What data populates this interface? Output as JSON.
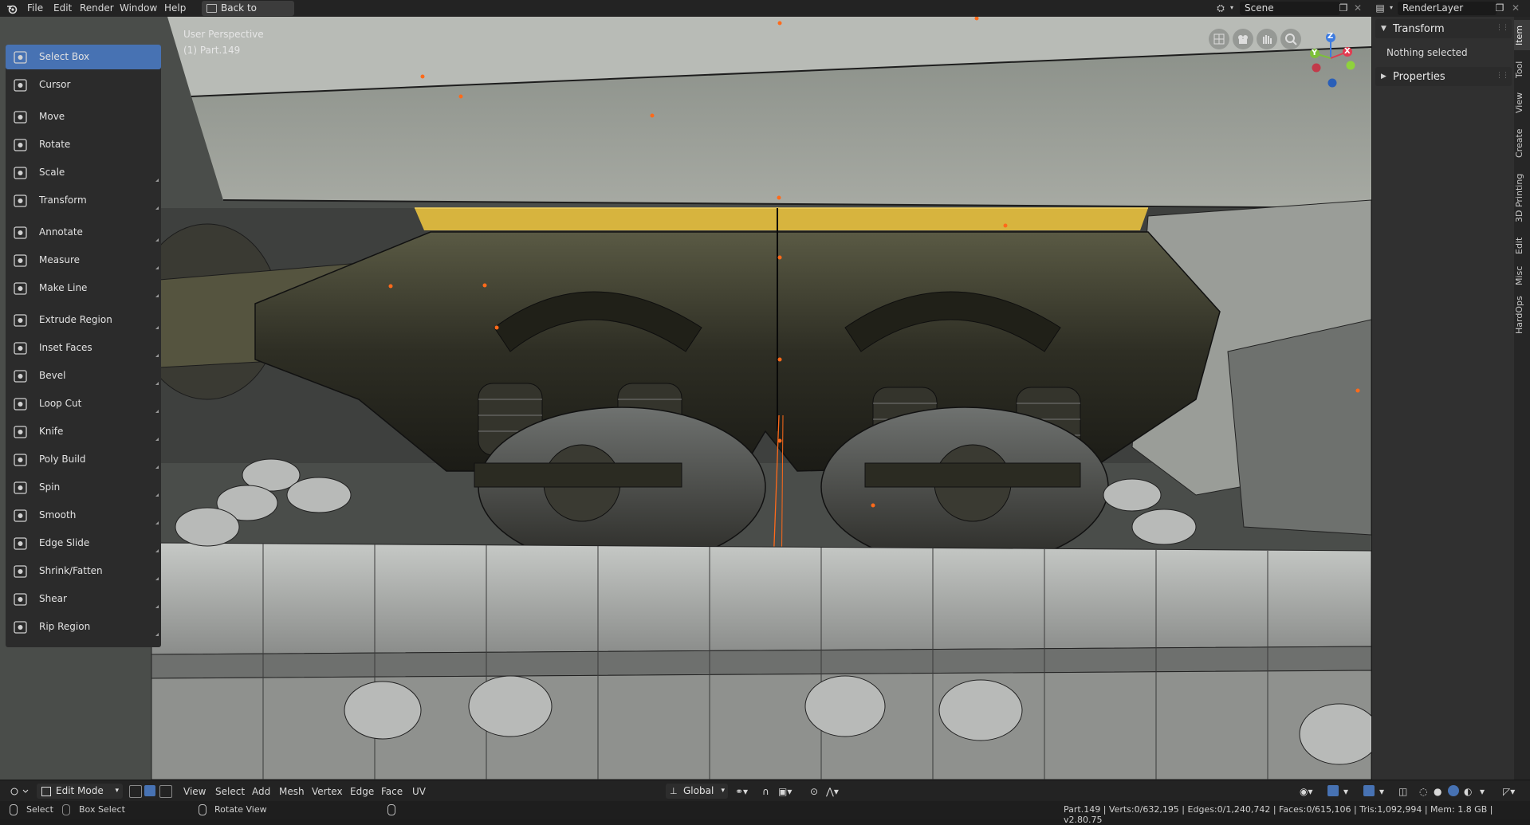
{
  "menu": {
    "items": [
      "File",
      "Edit",
      "Render",
      "Window",
      "Help"
    ],
    "back_to_previous": "Back to Previous"
  },
  "header_right": {
    "scene": "Scene",
    "render_layer": "RenderLayer"
  },
  "toolbar": {
    "tools": [
      {
        "label": "Select Box",
        "icon": "select-box-icon",
        "active": true
      },
      {
        "label": "Cursor",
        "icon": "cursor-icon"
      },
      {
        "label": "Move",
        "icon": "move-icon"
      },
      {
        "label": "Rotate",
        "icon": "rotate-icon"
      },
      {
        "label": "Scale",
        "icon": "scale-icon"
      },
      {
        "label": "Transform",
        "icon": "transform-icon"
      },
      {
        "label": "Annotate",
        "icon": "annotate-icon"
      },
      {
        "label": "Measure",
        "icon": "measure-icon"
      },
      {
        "label": "Make Line",
        "icon": "make-line-icon"
      },
      {
        "label": "Extrude Region",
        "icon": "extrude-region-icon"
      },
      {
        "label": "Inset Faces",
        "icon": "inset-faces-icon"
      },
      {
        "label": "Bevel",
        "icon": "bevel-icon"
      },
      {
        "label": "Loop Cut",
        "icon": "loop-cut-icon"
      },
      {
        "label": "Knife",
        "icon": "knife-icon"
      },
      {
        "label": "Poly Build",
        "icon": "poly-build-icon"
      },
      {
        "label": "Spin",
        "icon": "spin-icon"
      },
      {
        "label": "Smooth",
        "icon": "smooth-icon"
      },
      {
        "label": "Edge Slide",
        "icon": "edge-slide-icon"
      },
      {
        "label": "Shrink/Fatten",
        "icon": "shrink-fatten-icon"
      },
      {
        "label": "Shear",
        "icon": "shear-icon"
      },
      {
        "label": "Rip Region",
        "icon": "rip-region-icon"
      }
    ]
  },
  "viewport": {
    "view_name": "User Perspective",
    "object_name": "(1) Part.149",
    "gizmo": {
      "x": "X",
      "y": "Y",
      "z": "Z"
    },
    "colors": {
      "x_axis": "#e23a4f",
      "y_axis": "#7dbf3a",
      "z_axis": "#3d7be0",
      "selection": "#e6b840"
    }
  },
  "sidebar": {
    "transform_title": "Transform",
    "nothing_selected": "Nothing selected",
    "properties_title": "Properties",
    "tabs": [
      "Item",
      "Tool",
      "View",
      "Create",
      "3D Printing",
      "Edit",
      "Misc",
      "HardOps"
    ]
  },
  "bottom_header": {
    "mode": "Edit Mode",
    "menus": [
      "View",
      "Select",
      "Add",
      "Mesh",
      "Vertex",
      "Edge",
      "Face",
      "UV"
    ],
    "orientation": "Global"
  },
  "status": {
    "select": "Select",
    "box_select": "Box Select",
    "rotate_view": "Rotate View",
    "stats": "Part.149 | Verts:0/632,195 | Edges:0/1,240,742 | Faces:0/615,106 | Tris:1,092,994 | Mem: 1.8 GB | v2.80.75"
  }
}
